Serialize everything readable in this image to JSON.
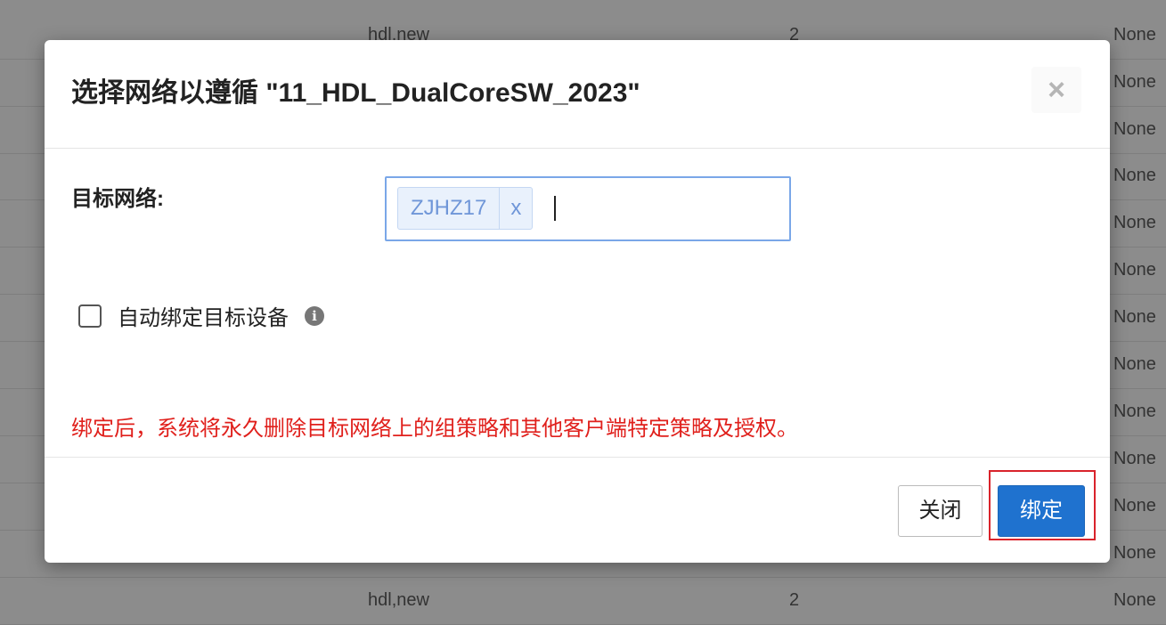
{
  "background_table": {
    "rows": [
      {
        "name": "hdl,new",
        "count": "2",
        "status": "None"
      },
      {
        "name": "",
        "count": "",
        "status": "None"
      },
      {
        "name": "",
        "count": "",
        "status": "None"
      },
      {
        "name": "",
        "count": "",
        "status": "None"
      },
      {
        "name": "",
        "count": "",
        "status": "None"
      },
      {
        "name": "",
        "count": "",
        "status": "None"
      },
      {
        "name": "",
        "count": "",
        "status": "None"
      },
      {
        "name": "",
        "count": "",
        "status": "None"
      },
      {
        "name": "",
        "count": "",
        "status": "None"
      },
      {
        "name": "",
        "count": "",
        "status": "None"
      },
      {
        "name": "",
        "count": "",
        "status": "None"
      },
      {
        "name": "",
        "count": "",
        "status": "None"
      },
      {
        "name": "hdl,new",
        "count": "2",
        "status": "None"
      }
    ]
  },
  "modal": {
    "title": "选择网络以遵循 \"11_HDL_DualCoreSW_2023\"",
    "close_icon": "×",
    "target_network_label": "目标网络:",
    "selected_tags": [
      {
        "label": "ZJHZ17",
        "remove": "x"
      }
    ],
    "auto_bind_label": "自动绑定目标设备",
    "auto_bind_checked": false,
    "info_icon": "i",
    "warning_text": "绑定后，系统将永久删除目标网络上的组策略和其他客户端特定策略及授权。",
    "buttons": {
      "close": "关闭",
      "bind": "绑定"
    }
  },
  "colors": {
    "primary": "#1f72cf",
    "warning": "#e0201c",
    "highlight": "#d9232b"
  }
}
